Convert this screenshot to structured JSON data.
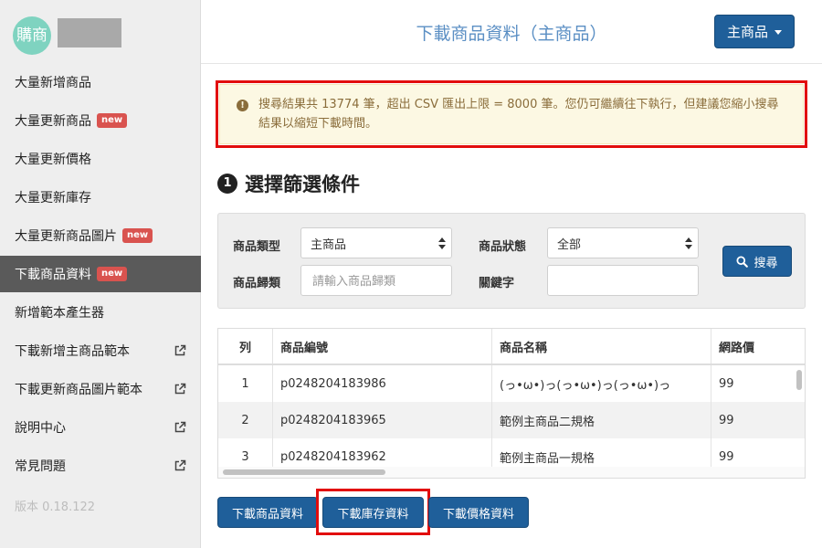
{
  "sidebar": {
    "avatar_text": "購商",
    "items": [
      {
        "label": "大量新增商品",
        "badge": "",
        "external": false
      },
      {
        "label": "大量更新商品",
        "badge": "new",
        "external": false
      },
      {
        "label": "大量更新價格",
        "badge": "",
        "external": false
      },
      {
        "label": "大量更新庫存",
        "badge": "",
        "external": false
      },
      {
        "label": "大量更新商品圖片",
        "badge": "new",
        "external": false
      },
      {
        "label": "下載商品資料",
        "badge": "new",
        "external": false,
        "active": true
      },
      {
        "label": "新增範本產生器",
        "badge": "",
        "external": false
      },
      {
        "label": "下載新增主商品範本",
        "badge": "",
        "external": true
      },
      {
        "label": "下載更新商品圖片範本",
        "badge": "",
        "external": true
      },
      {
        "label": "說明中心",
        "badge": "",
        "external": true
      },
      {
        "label": "常見問題",
        "badge": "",
        "external": true
      }
    ],
    "version": "版本 0.18.122"
  },
  "header": {
    "title": "下載商品資料（主商品）",
    "main_button": "主商品"
  },
  "alert": {
    "icon": "exclamation-circle-icon",
    "text": "搜尋結果共 13774 筆，超出 CSV 匯出上限 = 8000 筆。您仍可繼續往下執行，但建議您縮小搜尋結果以縮短下載時間。"
  },
  "section": {
    "number": "1",
    "title": "選擇篩選條件"
  },
  "filters": {
    "type_label": "商品類型",
    "type_value": "主商品",
    "status_label": "商品狀態",
    "status_value": "全部",
    "category_label": "商品歸類",
    "category_placeholder": "請輸入商品歸類",
    "keyword_label": "關鍵字",
    "keyword_value": "",
    "search_button": "搜尋"
  },
  "table": {
    "headers": [
      "列",
      "商品編號",
      "商品名稱",
      "網路價"
    ],
    "rows": [
      [
        "1",
        "p0248204183986",
        "(っ•ω•)っ(っ•ω•)っ(っ•ω•)っ",
        "99"
      ],
      [
        "2",
        "p0248204183965",
        "範例主商品二規格",
        "99"
      ],
      [
        "3",
        "p0248204183962",
        "範例主商品一規格",
        "99"
      ]
    ]
  },
  "actions": {
    "download_product": "下載商品資料",
    "download_inventory": "下載庫存資料",
    "download_price": "下載價格資料"
  },
  "colors": {
    "primary": "#1f5f9a",
    "highlight_outline": "#e20d0d",
    "badge": "#d9534f",
    "title": "#5b8fc4"
  }
}
